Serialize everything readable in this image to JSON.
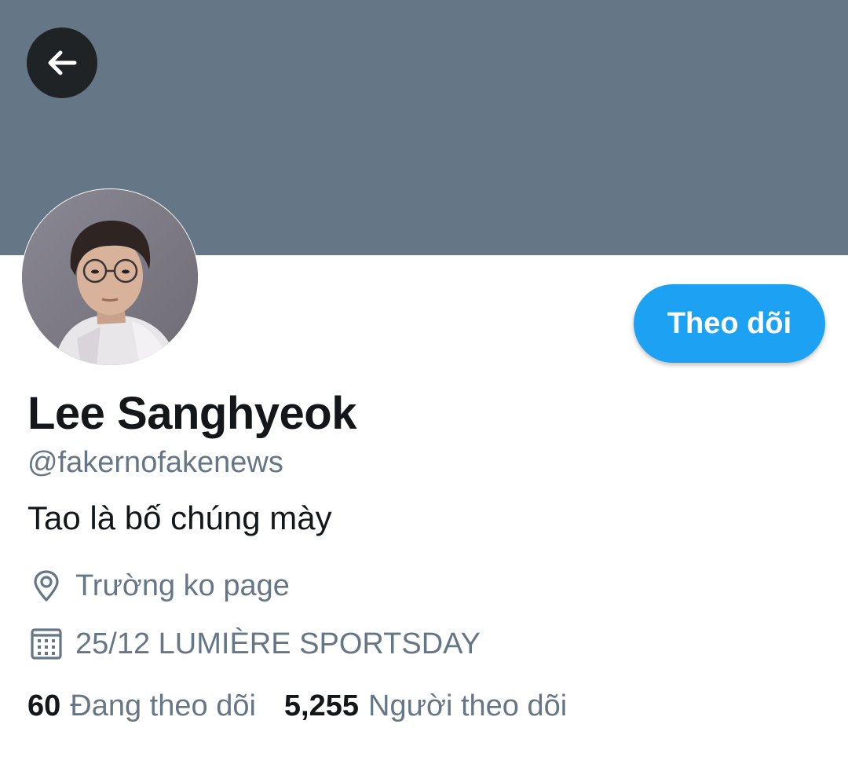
{
  "profile": {
    "display_name": "Lee Sanghyeok",
    "handle": "@fakernofakenews",
    "bio": "Tao là bố chúng mày",
    "location": "Trường ko page",
    "joined": "25/12 LUMIÈRE SPORTSDAY",
    "follow_label": "Theo dõi",
    "following_count": "60",
    "following_label": "Đang theo dõi",
    "followers_count": "5,255",
    "followers_label": "Người theo dõi"
  },
  "icons": {
    "back": "arrow-left-icon",
    "location": "location-pin-icon",
    "calendar": "calendar-icon"
  },
  "colors": {
    "banner": "#657786",
    "accent": "#1da1f2",
    "primary_text": "#14171a",
    "secondary_text": "#657786"
  }
}
